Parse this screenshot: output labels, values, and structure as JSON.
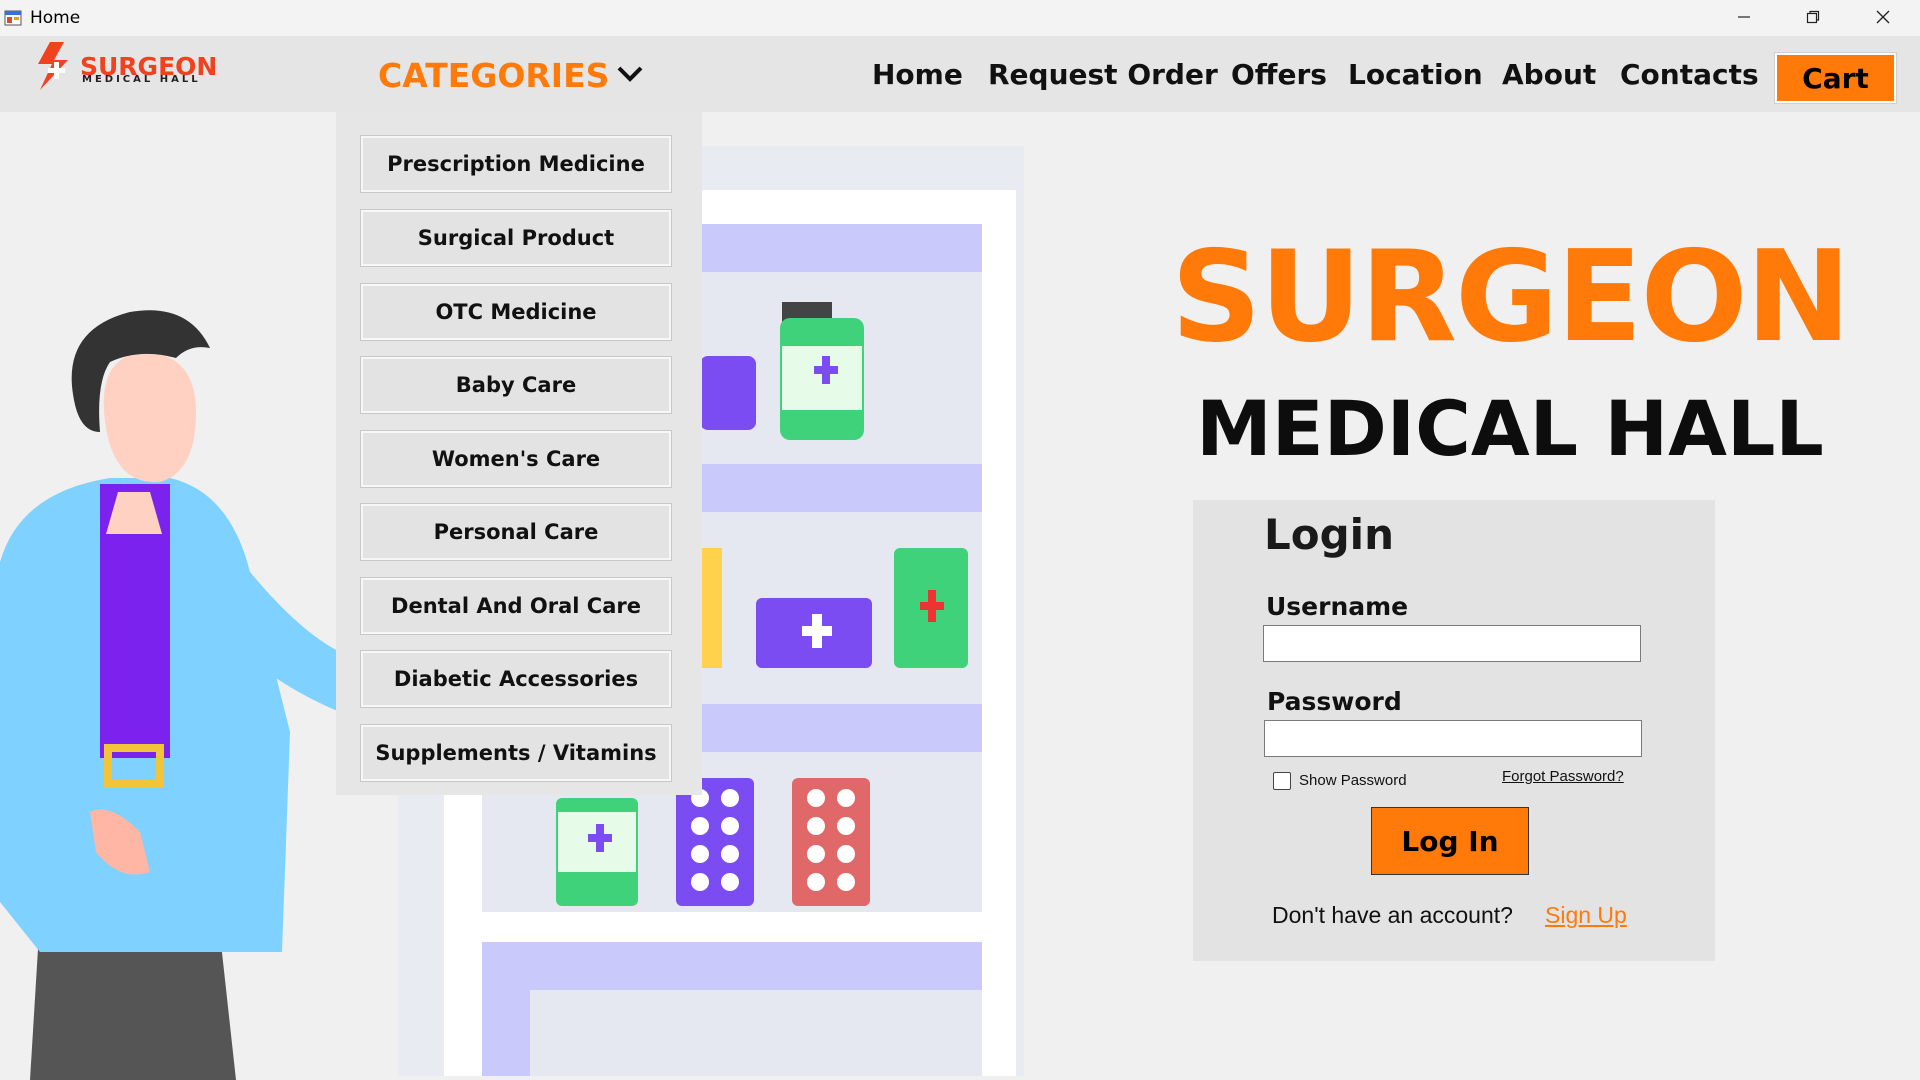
{
  "window": {
    "title": "Home",
    "controls": {
      "minimize": "minimize-icon",
      "maximize": "restore-icon",
      "close": "close-icon"
    }
  },
  "header": {
    "logo": {
      "line1": "SURGEON",
      "line2": "MEDICAL HALL"
    },
    "categories_label": "CATEGORIES",
    "nav": [
      "Home",
      "Request Order",
      "Offers",
      "Location",
      "About",
      "Contacts"
    ],
    "cart_label": "Cart"
  },
  "categories_menu": [
    "Prescription Medicine",
    "Surgical Product",
    "OTC Medicine",
    "Baby Care",
    "Women's Care",
    "Personal Care",
    "Dental And Oral Care",
    "Diabetic Accessories",
    "Supplements / Vitamins"
  ],
  "hero": {
    "title": "SURGEON",
    "subtitle": "MEDICAL HALL"
  },
  "login": {
    "title": "Login",
    "username_label": "Username",
    "username_value": "",
    "password_label": "Password",
    "password_value": "",
    "show_password_label": "Show Password",
    "show_password_checked": false,
    "forgot_password_label": "Forgot Password?",
    "submit_label": "Log In",
    "no_account_text": "Don't have an account?",
    "sign_up_label": "Sign Up"
  },
  "colors": {
    "accent": "#ff7a08",
    "text": "#111111",
    "panel": "#e3e3e3"
  }
}
